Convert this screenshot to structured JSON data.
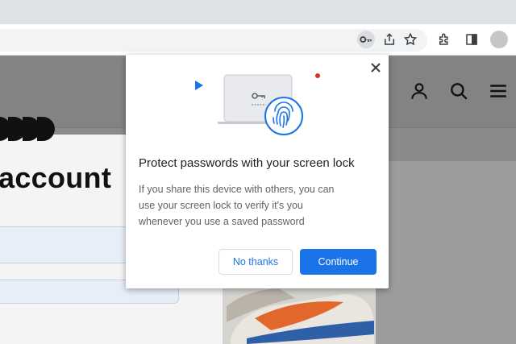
{
  "browser": {
    "toolbar_icons": [
      {
        "name": "key-icon",
        "active": true
      },
      {
        "name": "share-icon"
      },
      {
        "name": "bookmark-star-icon"
      },
      {
        "name": "extensions-icon"
      },
      {
        "name": "side-panel-icon"
      },
      {
        "name": "profile-avatar"
      }
    ]
  },
  "website": {
    "header_icons": [
      "user-icon",
      "search-icon",
      "menu-icon"
    ],
    "heading_fragment": "account"
  },
  "popup": {
    "title": "Protect passwords with your screen lock",
    "body_lines": [
      "If you share this device with others, you can",
      "use your screen lock to verify it's you",
      "whenever you use a saved password"
    ],
    "secondary_button": "No thanks",
    "primary_button": "Continue"
  },
  "colors": {
    "accent": "#1a73e8",
    "notification_dot": "#d93025",
    "overlay": "#8a8a8a"
  }
}
